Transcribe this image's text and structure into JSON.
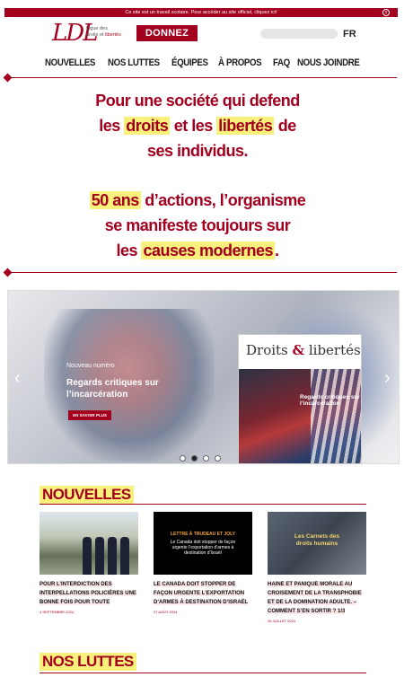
{
  "banner": {
    "text": "Ce site est un travail scolaire. Pour accéder au site officiel, cliquez ici!",
    "close_glyph": "x"
  },
  "header": {
    "logo_mark": "LDL",
    "logo_line1": "Ligue des",
    "logo_line2_a": "droits et",
    "logo_line2_b": "libertés",
    "donate_label": "DONNEZ",
    "lang_label": "FR"
  },
  "nav": [
    "NOUVELLES",
    "NOS LUTTES",
    "ÉQUIPES",
    "À PROPOS",
    "FAQ",
    "NOUS JOINDRE"
  ],
  "hero": {
    "l1": "Pour une société qui defend",
    "l2a": "les ",
    "l2b": "droits",
    "l2c": " et les ",
    "l2d": "libertés",
    "l2e": " de",
    "l3": "ses individus.",
    "l4a": "50 ans",
    "l4b": " d’actions, l’organisme",
    "l5": "se manifeste toujours sur",
    "l6a": "les ",
    "l6b": "causes modernes",
    "l6c": "."
  },
  "slider": {
    "eyebrow": "Nouveau numéro",
    "title": "Regards critiques sur l’incarcération",
    "button": "EN SAVOIR PLUS",
    "magazine_title_a": "Droits ",
    "magazine_amp": "&",
    "magazine_title_b": " libertés",
    "magazine_caption": "Regards critiques sur l’incarcération",
    "prev": "‹",
    "next": "›",
    "active_slide": 2,
    "slide_count": 4
  },
  "news": {
    "heading": "NOUVELLES",
    "items": [
      {
        "title": "POUR L’INTERDICTION DES INTERPELLATIONS POLICIÈRES UNE BONNE FOIS POUR TOUTE",
        "date": "4 SEPTEMBRE 2024"
      },
      {
        "title": "LE CANADA DOIT STOPPER DE FAÇON URGENTE L’EXPORTATION D’ARMES À DESTINATION D’ISRAËL",
        "date": "27 AOÛT 2024",
        "thumb_a": "LETTRE À TRUDEAU ET JOLY",
        "thumb_b": "Le Canada doit stopper de façon urgente l’exportation d’armes à destination d’Israël"
      },
      {
        "title": "HAINE ET PANIQUE MORALE AU CROISEMENT DE LA TRANSPHOBIE ET DE LA DOMINATION ADULTE. – COMMENT S’EN SORTIR ? 1/3",
        "date": "29 JUILLET 2024",
        "thumb_c": "Les Carnets des droits humains"
      }
    ]
  },
  "struggles": {
    "heading": "NOS LUTTES"
  },
  "colors": {
    "brand": "#a3001f",
    "highlight": "#f7f07a"
  }
}
